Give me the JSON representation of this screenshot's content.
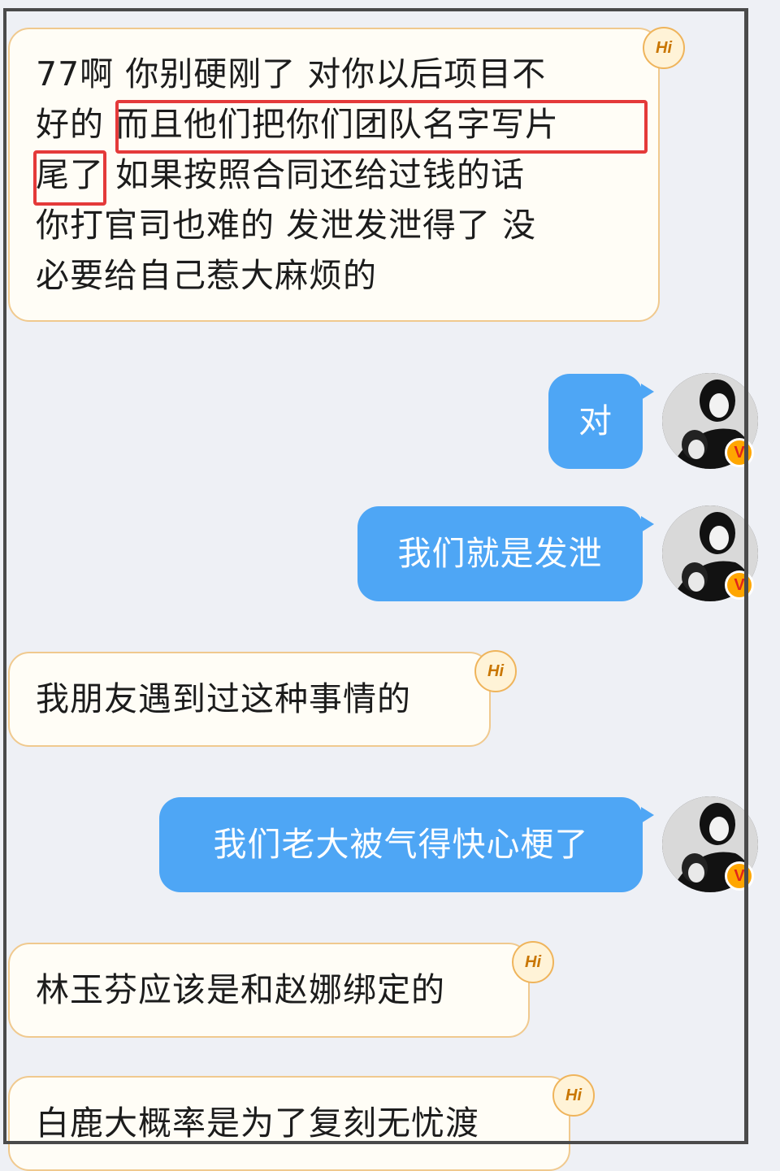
{
  "messages": [
    {
      "side": "in",
      "text": "77啊 你别硬刚了 对你以后项目不好的 而且他们把你们团队名字写片尾了 如果按照合同还给过钱的话 你打官司也难的 发泄发泄得了 没必要给自己惹大麻烦的",
      "lines": [
        "77啊 你别硬刚了 对你以后项目不",
        "好的 而且他们把你们团队名字写片",
        "尾了 如果按照合同还给过钱的话",
        "你打官司也难的 发泄发泄得了 没",
        "必要给自己惹大麻烦的"
      ],
      "highlighted": [
        "而且他们把你们团队名字写片",
        "尾了"
      ]
    },
    {
      "side": "out",
      "text": "对"
    },
    {
      "side": "out",
      "text": "我们就是发泄"
    },
    {
      "side": "in",
      "text": "我朋友遇到过这种事情的"
    },
    {
      "side": "out",
      "text": "我们老大被气得快心梗了"
    },
    {
      "side": "in",
      "text": "林玉芬应该是和赵娜绑定的"
    },
    {
      "side": "in",
      "text": "白鹿大概率是为了复刻无忧渡"
    }
  ],
  "badges": {
    "hi": "Hi",
    "verified": "V"
  },
  "icons": {
    "hi_badge": "hi-badge-icon",
    "verified": "verified-v-icon"
  },
  "colors": {
    "incoming_bg": "#fffdf6",
    "incoming_border": "#f0c98e",
    "outgoing_bg": "#4ea6f5",
    "highlight": "#e43a3a",
    "background": "#eef0f5"
  }
}
